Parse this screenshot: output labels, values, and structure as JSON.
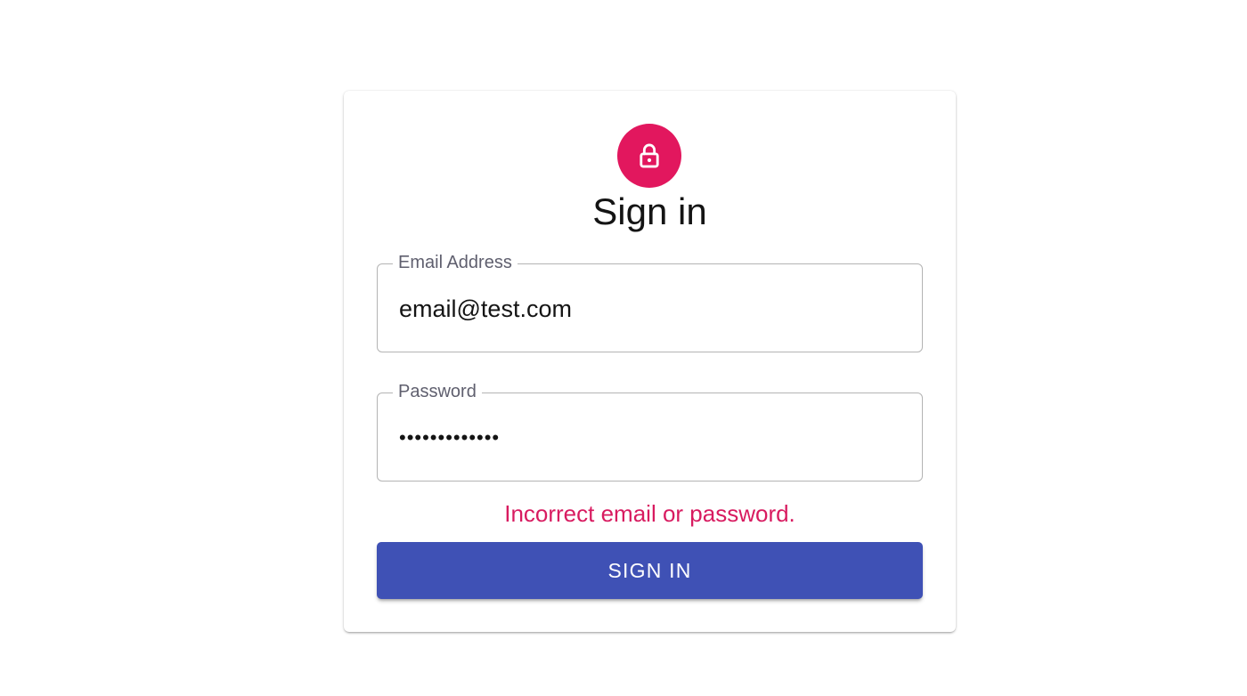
{
  "signin": {
    "title": "Sign in",
    "email": {
      "label": "Email Address",
      "value": "email@test.com"
    },
    "password": {
      "label": "Password",
      "value": "•••••••••••••"
    },
    "error": "Incorrect email or password.",
    "submit_label": "SIGN IN",
    "avatar_icon": "lock-icon",
    "colors": {
      "avatar": "#e2175e",
      "error": "#d81b60",
      "button": "#3f51b5"
    }
  }
}
